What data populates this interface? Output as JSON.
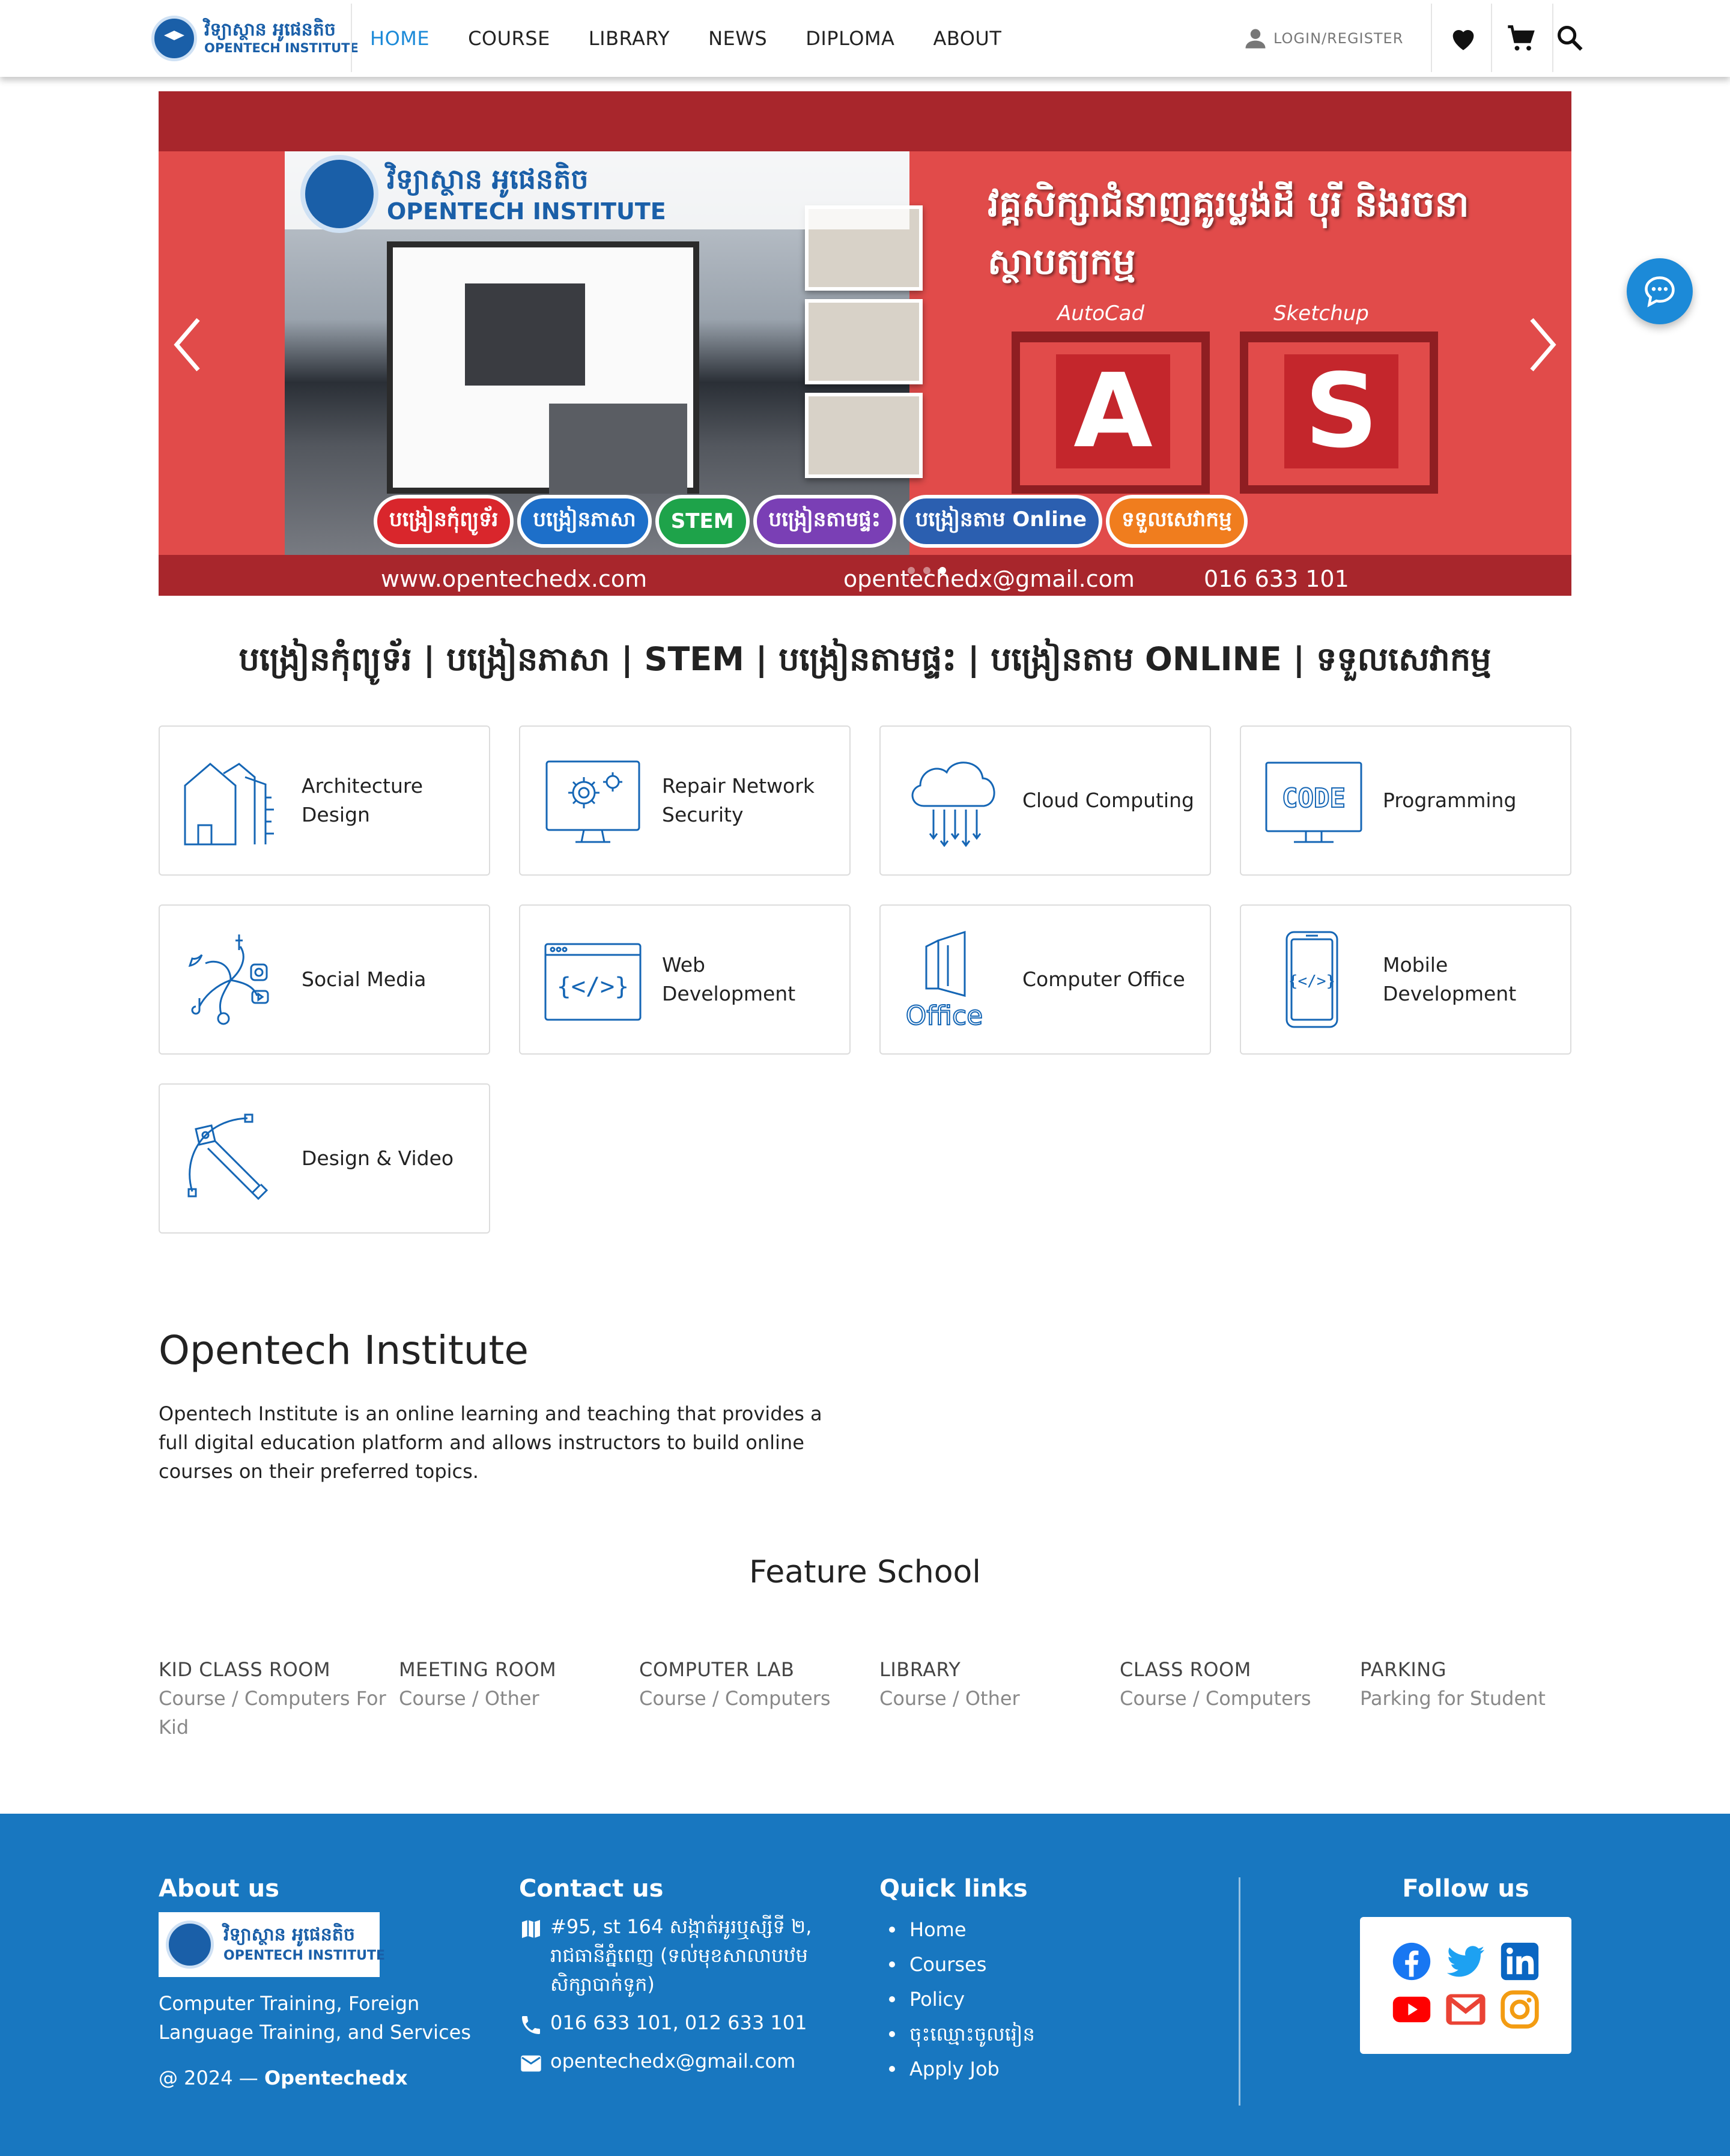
{
  "nav": {
    "logo_kh": "វិទ្យាស្ថាន អូផេនតិច",
    "logo_en": "OPENTECH INSTITUTE",
    "menu": [
      {
        "label": "HOME",
        "active": true
      },
      {
        "label": "COURSE",
        "active": false
      },
      {
        "label": "LIBRARY",
        "active": false
      },
      {
        "label": "NEWS",
        "active": false
      },
      {
        "label": "DIPLOMA",
        "active": false
      },
      {
        "label": "ABOUT",
        "active": false
      }
    ],
    "login_label": "LOGIN/REGISTER",
    "icons": [
      "user-icon",
      "heart-icon",
      "cart-icon",
      "search-icon"
    ]
  },
  "hero": {
    "logo_kh": "វិទ្យាស្ថាន អូផេនតិច",
    "logo_en": "OPENTECH INSTITUTE",
    "title": "វគ្គសិក្សាជំនាញគូរប្លង់ដី បុរី និងរចនាស្ថាបត្យកម្ម",
    "apps": [
      {
        "label": "AutoCad",
        "mark": "A"
      },
      {
        "label": "Sketchup",
        "mark": "S"
      }
    ],
    "pills": [
      {
        "label": "បង្រៀនកុំព្យូទ័រ",
        "color": "#d9262c"
      },
      {
        "label": "បង្រៀនភាសា",
        "color": "#1d6fc9"
      },
      {
        "label": "STEM",
        "color": "#1ea34a"
      },
      {
        "label": "បង្រៀនតាមផ្ទះ",
        "color": "#7a3fb5"
      },
      {
        "label": "បង្រៀនតាម Online",
        "color": "#2b5fb0"
      },
      {
        "label": "ទទួលសេវាកម្ម",
        "color": "#f07d1e"
      }
    ],
    "website": "www.opentechedx.com",
    "email": "opentechedx@gmail.com",
    "phone": "016 633 101",
    "slide_count": 3,
    "active_slide": 2
  },
  "tagline": "បង្រៀនកុំព្យូទ័រ | បង្រៀនភាសា | STEM | បង្រៀនតាមផ្ទះ  | បង្រៀនតាម ONLINE | ទទួលសេវាកម្ម",
  "categories": [
    {
      "label": "Architecture Design",
      "icon": "architecture-icon"
    },
    {
      "label": "Repair Network Security",
      "icon": "monitor-gear-icon"
    },
    {
      "label": "Cloud Computing",
      "icon": "cloud-computing-icon"
    },
    {
      "label": "Programming",
      "icon": "code-monitor-icon"
    },
    {
      "label": "Social Media",
      "icon": "social-media-icon"
    },
    {
      "label": "Web Development",
      "icon": "browser-code-icon"
    },
    {
      "label": "Computer Office",
      "icon": "office-icon"
    },
    {
      "label": "Mobile Development",
      "icon": "mobile-code-icon"
    },
    {
      "label": "Design & Video",
      "icon": "pen-tool-icon"
    }
  ],
  "about": {
    "title": "Opentech Institute",
    "text": "Opentech Institute is an online learning and teaching that provides a full digital education platform and allows instructors to build online courses on their preferred topics."
  },
  "feature_school": {
    "title": "Feature School",
    "items": [
      {
        "name": "KID CLASS ROOM",
        "sub": "Course / Computers For Kid"
      },
      {
        "name": "MEETING ROOM",
        "sub": "Course / Other"
      },
      {
        "name": "COMPUTER LAB",
        "sub": "Course / Computers"
      },
      {
        "name": "LIBRARY",
        "sub": "Course / Other"
      },
      {
        "name": "CLASS ROOM",
        "sub": "Course / Computers"
      },
      {
        "name": "PARKING",
        "sub": "Parking for Student"
      }
    ]
  },
  "footer": {
    "about_heading": "About us",
    "logo_kh": "វិទ្យាស្ថាន អូផេនតិច",
    "logo_en": "OPENTECH INSTITUTE",
    "about_text": "Computer Training, Foreign Language Training, and Services",
    "copyright_prefix": "@ 2024 — ",
    "copyright_brand": "Opentechedx",
    "contact_heading": "Contact us",
    "address": "#95, st 164 សង្កាត់អូរឬស្សីទី ២, រាជធានីភ្នំពេញ (ទល់មុខសាលាបឋមសិក្សាបាក់ទូក)",
    "phones": "016 633 101, 012 633 101",
    "email": "opentechedx@gmail.com",
    "links_heading": "Quick links",
    "links": [
      "Home",
      "Courses",
      "Policy",
      "ចុះឈ្មោះចូលរៀន",
      "Apply Job"
    ],
    "follow_heading": "Follow us",
    "social": [
      {
        "name": "facebook-icon",
        "color": "#1877f2"
      },
      {
        "name": "twitter-icon",
        "color": "#1da1f2"
      },
      {
        "name": "linkedin-icon",
        "color": "#0a66c2"
      },
      {
        "name": "youtube-icon",
        "color": "#ff0000"
      },
      {
        "name": "gmail-icon",
        "color": "#ea4335"
      },
      {
        "name": "instagram-icon",
        "color": "#f39c12"
      }
    ]
  },
  "colors": {
    "accent": "#1c8ad8",
    "footer_bg": "#1877c0",
    "hero_bg": "#e14b4a"
  }
}
